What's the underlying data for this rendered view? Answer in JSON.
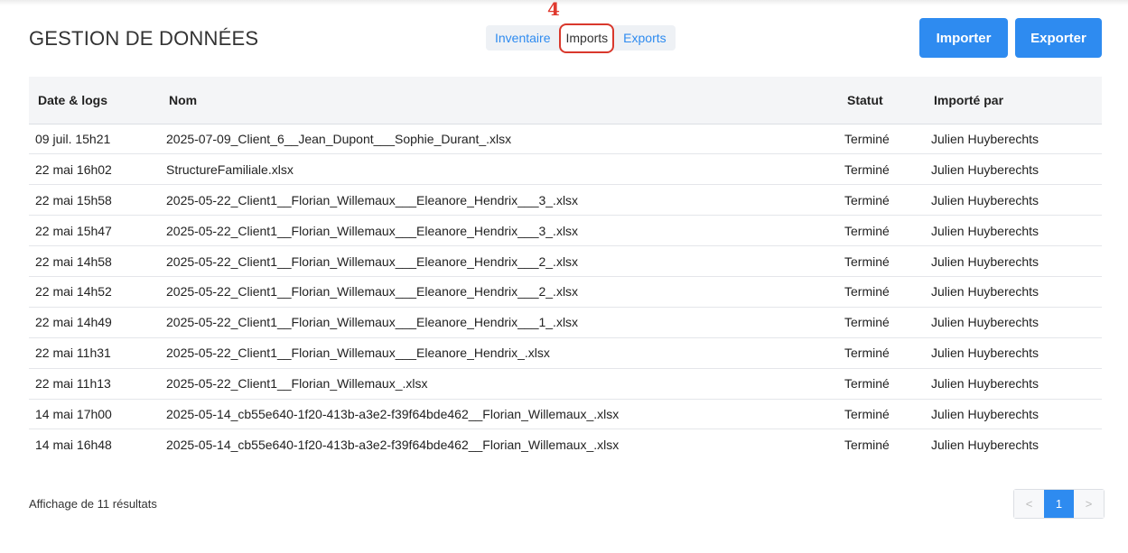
{
  "header": {
    "title": "GESTION DE DONNÉES",
    "annotation_number": "4",
    "tabs": [
      {
        "label": "Inventaire",
        "active": false
      },
      {
        "label": "Imports",
        "active": true
      },
      {
        "label": "Exports",
        "active": false
      }
    ],
    "import_button": "Importer",
    "export_button": "Exporter"
  },
  "table": {
    "columns": [
      "Date & logs",
      "Nom",
      "Statut",
      "Importé par"
    ],
    "rows": [
      [
        "09 juil. 15h21",
        "2025-07-09_Client_6__Jean_Dupont___Sophie_Durant_.xlsx",
        "Terminé",
        "Julien Huyberechts"
      ],
      [
        "22 mai 16h02",
        "StructureFamiliale.xlsx",
        "Terminé",
        "Julien Huyberechts"
      ],
      [
        "22 mai 15h58",
        "2025-05-22_Client1__Florian_Willemaux___Eleanore_Hendrix___3_.xlsx",
        "Terminé",
        "Julien Huyberechts"
      ],
      [
        "22 mai 15h47",
        "2025-05-22_Client1__Florian_Willemaux___Eleanore_Hendrix___3_.xlsx",
        "Terminé",
        "Julien Huyberechts"
      ],
      [
        "22 mai 14h58",
        "2025-05-22_Client1__Florian_Willemaux___Eleanore_Hendrix___2_.xlsx",
        "Terminé",
        "Julien Huyberechts"
      ],
      [
        "22 mai 14h52",
        "2025-05-22_Client1__Florian_Willemaux___Eleanore_Hendrix___2_.xlsx",
        "Terminé",
        "Julien Huyberechts"
      ],
      [
        "22 mai 14h49",
        "2025-05-22_Client1__Florian_Willemaux___Eleanore_Hendrix___1_.xlsx",
        "Terminé",
        "Julien Huyberechts"
      ],
      [
        "22 mai 11h31",
        "2025-05-22_Client1__Florian_Willemaux___Eleanore_Hendrix_.xlsx",
        "Terminé",
        "Julien Huyberechts"
      ],
      [
        "22 mai 11h13",
        "2025-05-22_Client1__Florian_Willemaux_.xlsx",
        "Terminé",
        "Julien Huyberechts"
      ],
      [
        "14 mai 17h00",
        "2025-05-14_cb55e640-1f20-413b-a3e2-f39f64bde462__Florian_Willemaux_.xlsx",
        "Terminé",
        "Julien Huyberechts"
      ],
      [
        "14 mai 16h48",
        "2025-05-14_cb55e640-1f20-413b-a3e2-f39f64bde462__Florian_Willemaux_.xlsx",
        "Terminé",
        "Julien Huyberechts"
      ]
    ]
  },
  "footer": {
    "results_text": "Affichage de 11 résultats",
    "pagination": {
      "prev": "<",
      "current": "1",
      "next": ">"
    }
  },
  "colors": {
    "accent": "#2e8bf0",
    "annotation": "#d9382c"
  }
}
